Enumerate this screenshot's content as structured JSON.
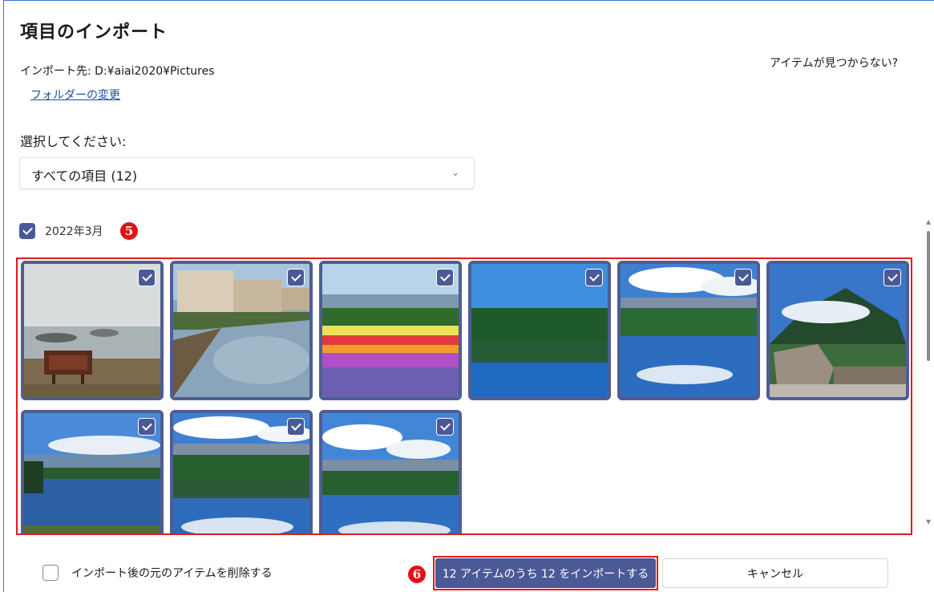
{
  "dialog": {
    "title": "項目のインポート",
    "destination": "インポート先: D:¥aiai2020¥Pictures",
    "change_folder": "フォルダーの変更",
    "missing_items": "アイテムが見つからない?"
  },
  "select": {
    "label": "選択してください:",
    "value": "すべての項目 (12)"
  },
  "group": {
    "label": "2022年3月",
    "checked": true,
    "marker": "5"
  },
  "photos": [
    {
      "scene": "foggy-coast-signboard",
      "checked": true
    },
    {
      "scene": "canal-town",
      "checked": true
    },
    {
      "scene": "flower-fields",
      "checked": true
    },
    {
      "scene": "forest-lake",
      "checked": true
    },
    {
      "scene": "mountain-lake-reflection",
      "checked": true
    },
    {
      "scene": "volcano-stone-monument",
      "checked": true
    },
    {
      "scene": "lakeshore-reeds",
      "checked": true
    },
    {
      "scene": "lake-clouds-reflection",
      "checked": true
    },
    {
      "scene": "lake-clouds-reflection-2",
      "checked": true
    }
  ],
  "footer": {
    "delete_after_import": "インポート後の元のアイテムを削除する",
    "delete_checked": false,
    "import_button": "12 アイテムのうち 12 をインポートする",
    "cancel_button": "キャンセル",
    "marker": "6"
  },
  "colors": {
    "accent": "#4a5a96",
    "highlight": "#e21b1b",
    "link": "#1f4f9c"
  }
}
